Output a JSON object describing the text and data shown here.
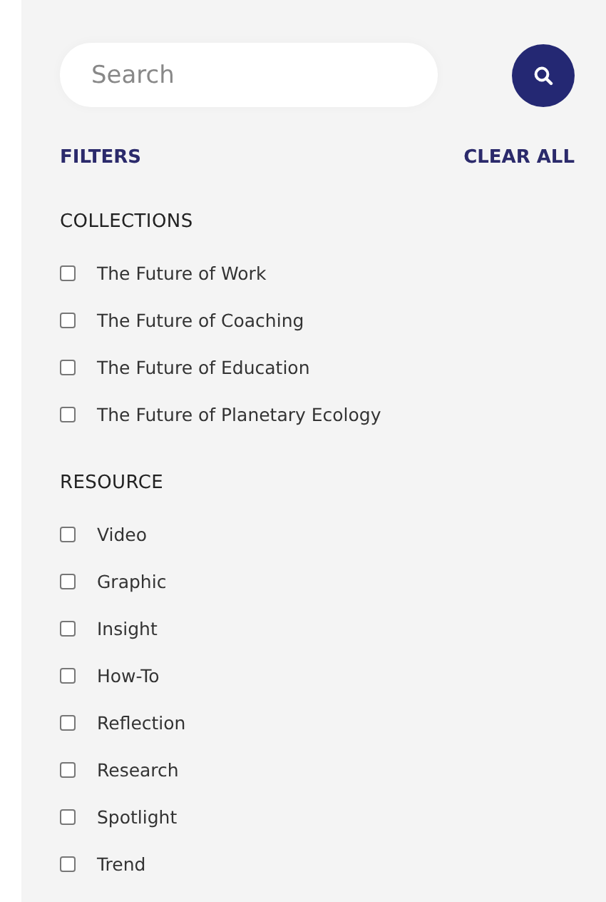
{
  "search": {
    "placeholder": "Search"
  },
  "filters_header": {
    "title": "FILTERS",
    "clear": "CLEAR ALL"
  },
  "groups": [
    {
      "title": "COLLECTIONS",
      "options": [
        {
          "label": "The Future of Work",
          "checked": false
        },
        {
          "label": "The Future of Coaching",
          "checked": false
        },
        {
          "label": "The Future of Education",
          "checked": false
        },
        {
          "label": "The Future of Planetary Ecology",
          "checked": false
        }
      ]
    },
    {
      "title": "RESOURCE",
      "options": [
        {
          "label": "Video",
          "checked": false
        },
        {
          "label": "Graphic",
          "checked": false
        },
        {
          "label": "Insight",
          "checked": false
        },
        {
          "label": "How-To",
          "checked": false
        },
        {
          "label": "Reflection",
          "checked": false
        },
        {
          "label": "Research",
          "checked": false
        },
        {
          "label": "Spotlight",
          "checked": false
        },
        {
          "label": "Trend",
          "checked": false
        }
      ]
    }
  ]
}
